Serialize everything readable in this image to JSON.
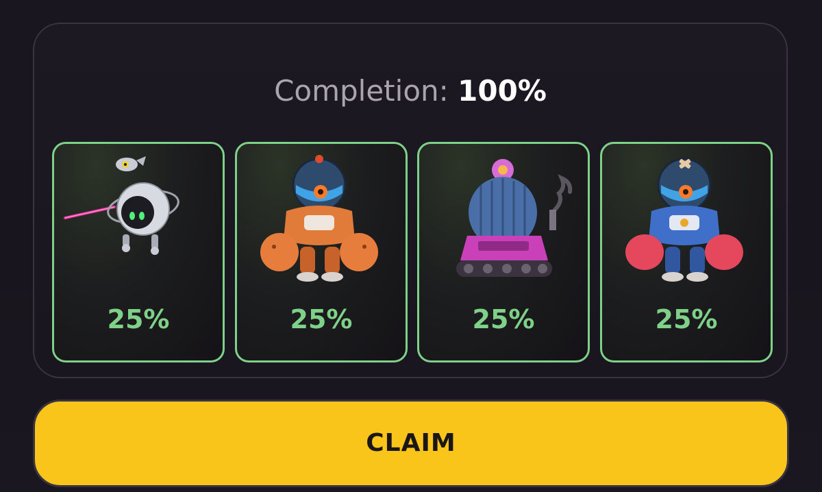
{
  "completion": {
    "label": "Completion:",
    "value": "100%"
  },
  "cards": [
    {
      "percent": "25%",
      "icon": "orbital-drone-robot-icon"
    },
    {
      "percent": "25%",
      "icon": "orange-mech-robot-icon"
    },
    {
      "percent": "25%",
      "icon": "cactus-tank-robot-icon"
    },
    {
      "percent": "25%",
      "icon": "blue-mech-robot-icon"
    }
  ],
  "claim": {
    "label": "CLAIM"
  },
  "colors": {
    "accent_green": "#7fd18a",
    "claim_yellow": "#f9c51a",
    "background": "#1a1620"
  }
}
